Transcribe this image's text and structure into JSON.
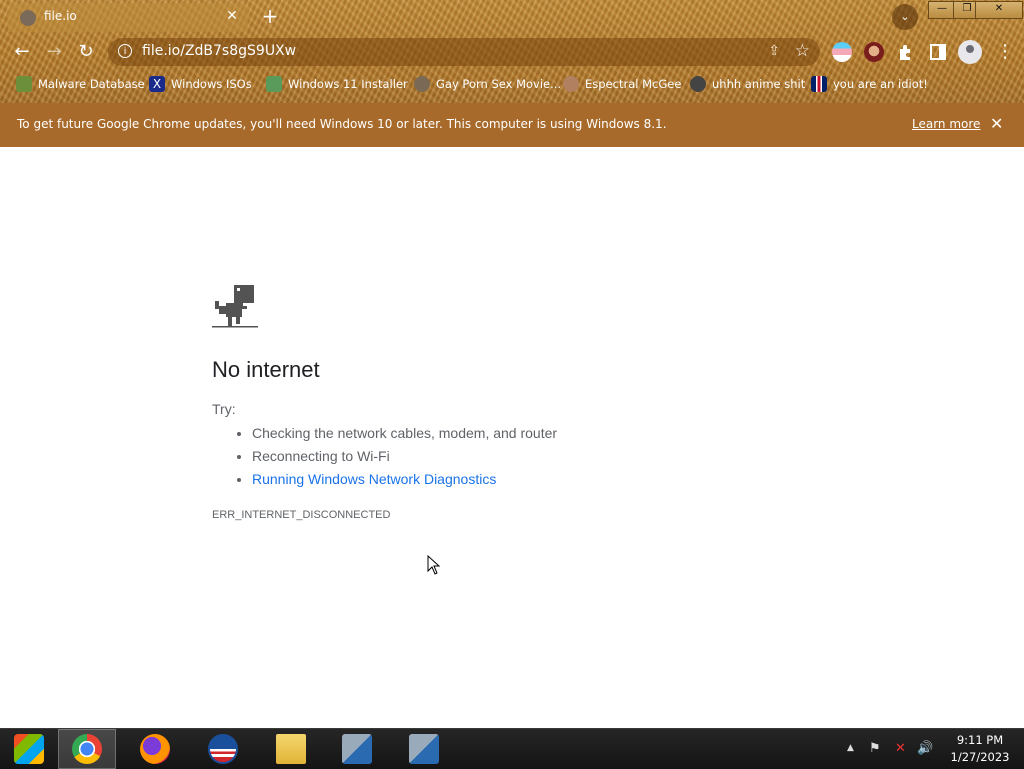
{
  "tab": {
    "title": "file.io",
    "close_label": "✕"
  },
  "toolbar": {
    "new_tab_label": "+",
    "back": "←",
    "forward": "→",
    "reload": "↻",
    "tab_search": "⌄",
    "menu": "⋮"
  },
  "window_controls": {
    "minimize": "—",
    "maximize": "❐",
    "close": "✕"
  },
  "omnibox": {
    "url": "file.io/ZdB7s8gS9UXw",
    "info": "i",
    "share": "⇪",
    "star": "☆"
  },
  "bookmarks": [
    {
      "label": "Malware Database",
      "icon": "malware-database-icon",
      "color": "#6b8f3a"
    },
    {
      "label": "Windows ISOs",
      "icon": "windows-isos-icon",
      "color": "#1a2a8a"
    },
    {
      "label": "Windows 11 Installer",
      "icon": "installer-icon",
      "color": "#5a9a5a"
    },
    {
      "label": "Gay Porn Sex Movie...",
      "icon": "globe-icon",
      "color": "#7a6a55"
    },
    {
      "label": "Espectral McGee",
      "icon": "face-icon",
      "color": "#b08060"
    },
    {
      "label": "uhhh anime shit",
      "icon": "anime-icon",
      "color": "#444"
    },
    {
      "label": "you are an idiot!",
      "icon": "flag-icon",
      "color": "#c33"
    }
  ],
  "infobar": {
    "message": "To get future Google Chrome updates, you'll need Windows 10 or later. This computer is using Windows 8.1.",
    "learn_more": "Learn more",
    "close": "✕"
  },
  "error": {
    "title": "No internet",
    "try_label": "Try:",
    "suggestions": [
      "Checking the network cables, modem, and router",
      "Reconnecting to Wi-Fi",
      "Running Windows Network Diagnostics"
    ],
    "code": "ERR_INTERNET_DISCONNECTED"
  },
  "taskbar": {
    "items": [
      {
        "name": "start-button",
        "icon": "windows-icon"
      },
      {
        "name": "taskbar-chrome",
        "icon": "chrome-icon"
      },
      {
        "name": "taskbar-firefox",
        "icon": "firefox-icon"
      },
      {
        "name": "taskbar-obama-app",
        "icon": "obama-logo-icon"
      },
      {
        "name": "taskbar-file-explorer",
        "icon": "folder-icon"
      },
      {
        "name": "taskbar-network-app-1",
        "icon": "network-setup-icon"
      },
      {
        "name": "taskbar-network-app-2",
        "icon": "network-setup-icon"
      }
    ],
    "tray": {
      "chevron": "▲",
      "flag": "⚑",
      "network": "✕",
      "volume": "🔊"
    },
    "time": "9:11 PM",
    "date": "1/27/2023"
  },
  "colors": {
    "accent_brown": "#b57a2a",
    "infobar": "#a86a2a",
    "link": "#1a73e8"
  }
}
